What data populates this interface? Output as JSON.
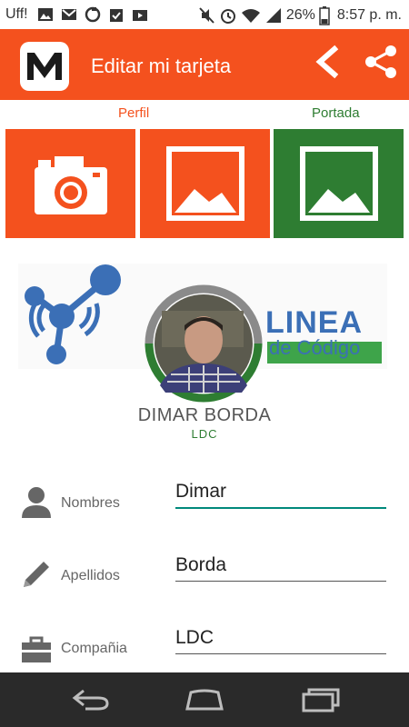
{
  "status_bar": {
    "carrier": "Uff!",
    "battery": "26%",
    "time": "8:57 p. m."
  },
  "app_bar": {
    "title": "Editar mi tarjeta",
    "logo_letter": "M"
  },
  "tabs": {
    "perfil": "Perfil",
    "portada": "Portada"
  },
  "banner": {
    "title": "LINEA",
    "subtitle": "de Código"
  },
  "profile": {
    "name": "DIMAR BORDA",
    "company": "LDC"
  },
  "form": {
    "nombres": {
      "label": "Nombres",
      "value": "Dimar"
    },
    "apellidos": {
      "label": "Apellidos",
      "value": "Borda"
    },
    "compania": {
      "label": "Compañia",
      "value": "LDC"
    }
  },
  "colors": {
    "accent": "#f4511e",
    "green": "#2e7d32",
    "blue": "#3b6fb6",
    "focus": "#00897b",
    "navbar": "#2a2a2a"
  },
  "icons": {
    "tile_1": "camera-icon",
    "tile_2": "image-icon",
    "tile_3": "image-icon",
    "nombres": "person-icon",
    "apellidos": "pencil-icon",
    "compania": "briefcase-icon"
  }
}
